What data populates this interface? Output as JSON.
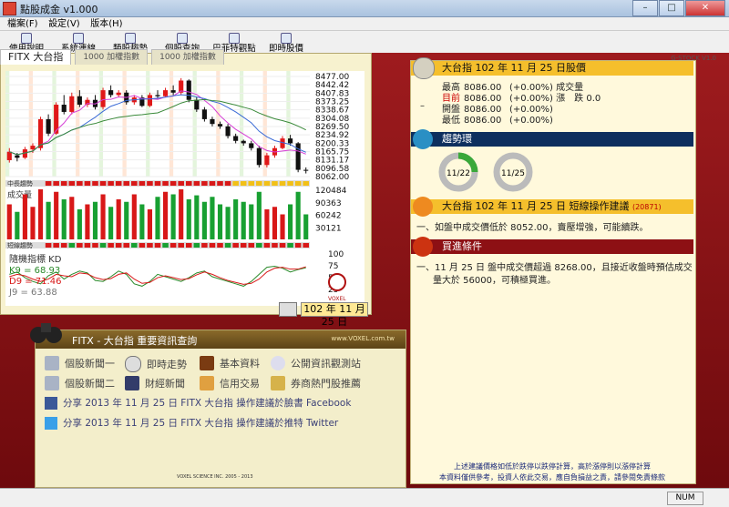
{
  "window": {
    "title": "點股成金 v1.000",
    "minimize": "–",
    "maximize": "□",
    "close": "✕"
  },
  "menu": [
    "檔案(F)",
    "設定(V)",
    "版本(H)"
  ],
  "toolbar": [
    "使用說明",
    "系統連線",
    "類股趨勢",
    "個股查詢",
    "巴菲特觀點",
    "即時股價"
  ],
  "tabs": [
    "FITX 大台指",
    "1000 加權指數",
    "1000 加權指數"
  ],
  "chart_version": "G-STOCK V1.0",
  "chart_data": {
    "type": "candlestick",
    "price_ticks": [
      "8477.00",
      "8442.42",
      "8407.83",
      "8373.25",
      "8338.67",
      "8304.08",
      "8269.50",
      "8234.92",
      "8200.33",
      "8165.75",
      "8131.17",
      "8096.58",
      "8062.00"
    ],
    "volume_ticks": [
      "120484",
      "90363",
      "60242",
      "30121"
    ],
    "kd_ticks": [
      "100",
      "75",
      "50",
      "25"
    ],
    "trend_labels": [
      "中長趨勢",
      "短線趨勢"
    ],
    "volume_label": "成交量",
    "kd_title": "隨機指標 KD",
    "k_value": "K9 = 68.93",
    "d_value": "D9 = 71.46",
    "j_value": "J9 = 63.88",
    "candles": [
      [
        8130,
        8165,
        8120,
        8180
      ],
      [
        8150,
        8140,
        8125,
        8160
      ],
      [
        8140,
        8175,
        8135,
        8185
      ],
      [
        8175,
        8190,
        8160,
        8200
      ],
      [
        8180,
        8300,
        8170,
        8310
      ],
      [
        8300,
        8240,
        8230,
        8320
      ],
      [
        8240,
        8360,
        8235,
        8370
      ],
      [
        8360,
        8330,
        8320,
        8400
      ],
      [
        8330,
        8395,
        8320,
        8410
      ],
      [
        8395,
        8360,
        8350,
        8420
      ],
      [
        8360,
        8380,
        8350,
        8390
      ],
      [
        8380,
        8350,
        8340,
        8400
      ],
      [
        8350,
        8420,
        8340,
        8430
      ],
      [
        8420,
        8400,
        8390,
        8440
      ],
      [
        8400,
        8410,
        8390,
        8420
      ],
      [
        8410,
        8370,
        8360,
        8420
      ],
      [
        8370,
        8390,
        8360,
        8400
      ],
      [
        8390,
        8355,
        8350,
        8400
      ],
      [
        8355,
        8400,
        8350,
        8410
      ],
      [
        8400,
        8395,
        8385,
        8420
      ],
      [
        8395,
        8420,
        8390,
        8430
      ],
      [
        8420,
        8410,
        8400,
        8440
      ],
      [
        8410,
        8460,
        8400,
        8470
      ],
      [
        8460,
        8380,
        8370,
        8465
      ],
      [
        8380,
        8340,
        8330,
        8390
      ],
      [
        8340,
        8300,
        8290,
        8350
      ],
      [
        8300,
        8280,
        8270,
        8310
      ],
      [
        8280,
        8270,
        8260,
        8290
      ],
      [
        8270,
        8230,
        8220,
        8280
      ],
      [
        8230,
        8210,
        8200,
        8240
      ],
      [
        8210,
        8200,
        8190,
        8215
      ],
      [
        8200,
        8180,
        8170,
        8210
      ],
      [
        8180,
        8110,
        8100,
        8190
      ],
      [
        8110,
        8150,
        8100,
        8160
      ],
      [
        8150,
        8180,
        8140,
        8190
      ],
      [
        8180,
        8220,
        8175,
        8230
      ],
      [
        8220,
        8200,
        8190,
        8235
      ],
      [
        8200,
        8090,
        8080,
        8205
      ],
      [
        8090,
        8086,
        8075,
        8100
      ]
    ],
    "volumes": [
      70,
      55,
      90,
      65,
      100,
      75,
      95,
      80,
      85,
      60,
      70,
      75,
      90,
      65,
      80,
      75,
      90,
      70,
      60,
      85,
      95,
      90,
      100,
      80,
      88,
      75,
      85,
      70,
      65,
      80,
      75,
      70,
      95,
      60,
      65,
      50,
      70,
      95,
      50
    ],
    "k_line": [
      55,
      60,
      48,
      40,
      35,
      52,
      60,
      45,
      55,
      62,
      58,
      42,
      40,
      50,
      62,
      55,
      35,
      30,
      40,
      55,
      50,
      45,
      40,
      48,
      58,
      62,
      50,
      45,
      40,
      35,
      30,
      40,
      55,
      70,
      72,
      68,
      60,
      65,
      69
    ],
    "d_line": [
      50,
      55,
      52,
      45,
      40,
      45,
      55,
      52,
      50,
      58,
      56,
      48,
      44,
      46,
      55,
      58,
      45,
      36,
      38,
      48,
      52,
      48,
      44,
      46,
      54,
      60,
      55,
      48,
      42,
      38,
      34,
      36,
      45,
      60,
      68,
      70,
      66,
      66,
      71
    ]
  },
  "chart_date": "102 年 11 月 25 日",
  "info": {
    "header": "FITX - 大台指 重要資訊查詢",
    "website": "www.VOXEL.com.tw",
    "links": [
      "個股新聞一",
      "即時走勢",
      "基本資料",
      "公開資訊觀測站",
      "個股新聞二",
      "財經新聞",
      "信用交易",
      "券商熱門股推薦"
    ],
    "share_facebook": "分享 2013 年 11 月 25 日 FITX 大台指 操作建議於臉書 Facebook",
    "share_twitter": "分享 2013 年 11 月 25 日 FITX 大台指 操作建議於推特 Twitter",
    "footer": "VOXEL SCIENCE INC. 2005 - 2013",
    "logo_text": "VOXEL"
  },
  "quote": {
    "title": "大台指 102 年 11 月 25 日股價",
    "rows": [
      {
        "label": "最高",
        "value": "8086.00",
        "pct": "(+0.00%)",
        "extra_label": "成交量",
        "extra_value": ""
      },
      {
        "label": "目前",
        "value": "8086.00",
        "pct": "(+0.00%)",
        "extra_label": "漲　跌",
        "extra_value": "0.0"
      },
      {
        "label": "開盤",
        "value": "8086.00",
        "pct": "(+0.00%)",
        "extra_label": "",
        "extra_value": ""
      },
      {
        "label": "最低",
        "value": "8086.00",
        "pct": "(+0.00%)",
        "extra_label": "",
        "extra_value": ""
      }
    ],
    "dash": "–"
  },
  "trend": {
    "title": "趨勢環",
    "dial1": "11/22",
    "dial2": "11/25"
  },
  "advice": {
    "title": "大台指 102 年 11 月 25 日 短線操作建議",
    "code": "(20871)",
    "text": "一、如盤中成交價低於 8052.00，賣壓增強，可能續跌。"
  },
  "buy": {
    "title": "買進條件",
    "line1": "一、11 月 25 日 盤中成交價超過 8268.00，且接近收盤時預估成交",
    "line2": "量大於 56000，可積極買進。"
  },
  "notes": {
    "line1": "上述建議價格如低於跌停以跌停計算，高於漲停則以漲停計算",
    "line2": "本資料僅供參考，投資人依此交易，應自負損益之責，請參閱免責條款"
  },
  "status": {
    "num": "NUM"
  },
  "colors": {
    "up": "#e01818",
    "down": "#111111",
    "accent": "#f5bf2c",
    "navy": "#0e2f5e"
  }
}
